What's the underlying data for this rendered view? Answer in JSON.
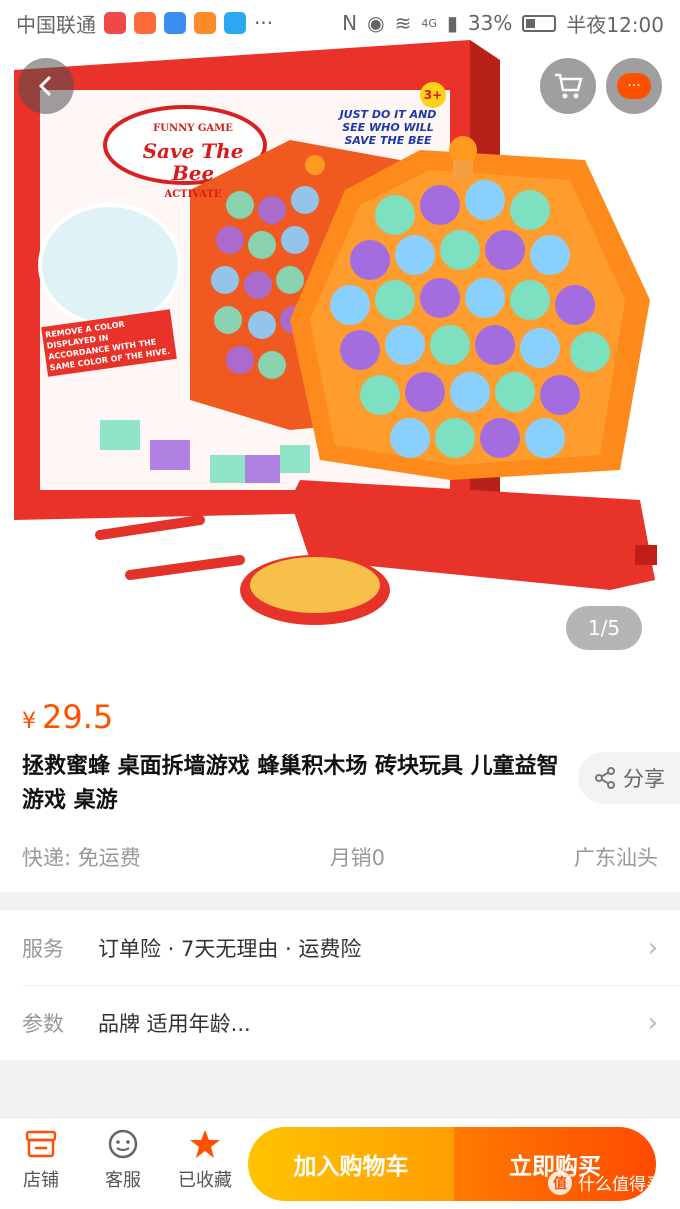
{
  "status_bar": {
    "carrier": "中国联通",
    "battery": "33%",
    "network": "4G",
    "time": "半夜12:00"
  },
  "hero": {
    "pager": "1/5",
    "box_brand": "FUNNY GAME",
    "box_title": "Save The Bee",
    "box_sub": "ACTIVATE",
    "box_slogan": "JUST DO IT AND SEE WHO WILL SAVE THE BEE",
    "box_age": "3+",
    "box_instr": "REMOVE A COLOR DISPLAYED IN ACCORDANCE WITH THE SAME COLOR OF THE HIVE.",
    "more_badge": "···"
  },
  "product": {
    "currency": "¥",
    "price": "29.5",
    "title": "拯救蜜蜂 桌面拆墙游戏 蜂巢积木场 砖块玩具 儿童益智游戏 桌游",
    "share_label": "分享",
    "shipping": "快递: 免运费",
    "monthly_sales": "月销0",
    "location": "广东汕头"
  },
  "services": [
    {
      "label": "服务",
      "value": "订单险 · 7天无理由 · 运费险"
    },
    {
      "label": "参数",
      "value": "品牌 适用年龄..."
    }
  ],
  "bottom_bar": {
    "shop": "店铺",
    "service": "客服",
    "favorited": "已收藏",
    "add_to_cart": "加入购物车",
    "buy_now": "立即购买"
  },
  "watermark": "什么值得买",
  "colors": {
    "accent": "#ff5000",
    "cart_btn": "#ffb000",
    "buy_btn": "#ff5a00"
  }
}
